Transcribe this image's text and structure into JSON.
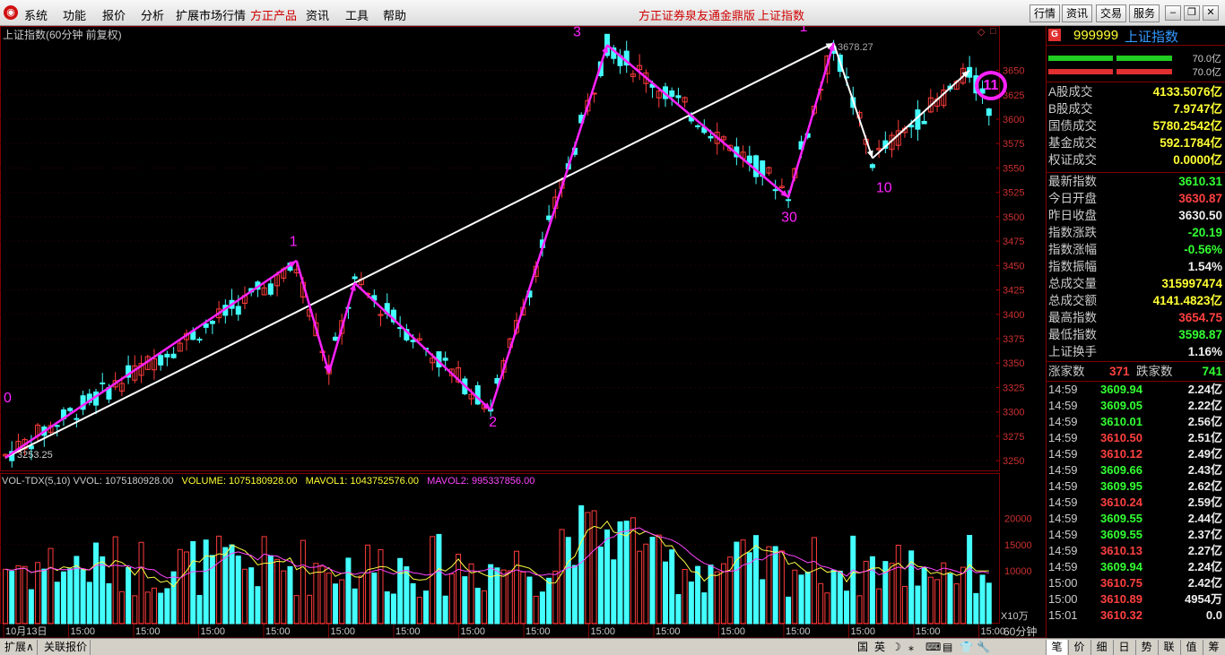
{
  "menu": [
    "系统",
    "功能",
    "报价",
    "分析",
    "扩展市场行情",
    "方正产品",
    "资讯",
    "工具",
    "帮助"
  ],
  "window_title": "方正证券泉友通金鼎版",
  "window_subtitle": "上证指数",
  "nav_buttons": [
    "行情",
    "资讯",
    "交易",
    "服务"
  ],
  "chart": {
    "title": "上证指数(60分钟 前复权)",
    "price_ticks": [
      "3650",
      "3625",
      "3600",
      "3575",
      "3550",
      "3525",
      "3500",
      "3475",
      "3450",
      "3425",
      "3400",
      "3375",
      "3350",
      "3325",
      "3300",
      "3275",
      "3250"
    ],
    "high_label": "3678.27",
    "low_label": "3253.25",
    "wave_labels": [
      "0",
      "1",
      "2",
      "3",
      "1",
      "30",
      "10"
    ],
    "current_badge": "11",
    "vol_header": {
      "name": "VOL-TDX(5,10)",
      "vvol": "VVOL: 1075180928.00",
      "volume": "VOLUME: 1075180928.00",
      "mavol1": "MAVOL1: 1043752576.00",
      "mavol2": "MAVOL2: 995337856.00"
    },
    "vol_ticks": [
      "20000",
      "15000",
      "10000"
    ],
    "vol_unit": "X10万",
    "time_axis": [
      "10月13日",
      "15:00",
      "15:00",
      "15:00",
      "15:00",
      "15:00",
      "15:00",
      "15:00",
      "15:00",
      "15:00",
      "15:00",
      "15:00",
      "15:00",
      "15:00",
      "15:00",
      "15:00"
    ],
    "period_label": "60分钟"
  },
  "side": {
    "code_icon": "G",
    "code": "999999",
    "name": "上证指数",
    "bars": [
      {
        "left": "70.0亿",
        "color": "#22cc22"
      },
      {
        "left": "70.0亿",
        "color": "#e03030"
      }
    ],
    "turnover": [
      {
        "label": "A股成交",
        "value": "4133.5076亿"
      },
      {
        "label": "B股成交",
        "value": "7.9747亿"
      },
      {
        "label": "国债成交",
        "value": "5780.2542亿"
      },
      {
        "label": "基金成交",
        "value": "592.1784亿"
      },
      {
        "label": "权证成交",
        "value": "0.0000亿"
      }
    ],
    "stats": [
      {
        "label": "最新指数",
        "value": "3610.31",
        "color": "#33ff33"
      },
      {
        "label": "今日开盘",
        "value": "3630.87",
        "color": "#ff4040"
      },
      {
        "label": "昨日收盘",
        "value": "3630.50",
        "color": "#eeeeee"
      },
      {
        "label": "指数涨跌",
        "value": "-20.19",
        "color": "#33ff33"
      },
      {
        "label": "指数涨幅",
        "value": "-0.56%",
        "color": "#33ff33"
      },
      {
        "label": "指数振幅",
        "value": "1.54%",
        "color": "#eeeeee"
      },
      {
        "label": "总成交量",
        "value": "315997474",
        "color": "#ffff33"
      },
      {
        "label": "总成交额",
        "value": "4141.4823亿",
        "color": "#ffff33"
      },
      {
        "label": "最高指数",
        "value": "3654.75",
        "color": "#ff4040"
      },
      {
        "label": "最低指数",
        "value": "3598.87",
        "color": "#33ff33"
      },
      {
        "label": "上证换手",
        "value": "1.16%",
        "color": "#eeeeee"
      }
    ],
    "updown": {
      "up_label": "涨家数",
      "up": "371",
      "down_label": "跌家数",
      "down": "741"
    },
    "ticks": [
      {
        "t": "14:59",
        "p": "3609.94",
        "v": "2.24亿"
      },
      {
        "t": "14:59",
        "p": "3609.05",
        "v": "2.22亿"
      },
      {
        "t": "14:59",
        "p": "3610.01",
        "v": "2.56亿"
      },
      {
        "t": "14:59",
        "p": "3610.50",
        "v": "2.51亿"
      },
      {
        "t": "14:59",
        "p": "3610.12",
        "v": "2.49亿"
      },
      {
        "t": "14:59",
        "p": "3609.66",
        "v": "2.43亿"
      },
      {
        "t": "14:59",
        "p": "3609.95",
        "v": "2.62亿"
      },
      {
        "t": "14:59",
        "p": "3610.24",
        "v": "2.59亿"
      },
      {
        "t": "14:59",
        "p": "3609.55",
        "v": "2.44亿"
      },
      {
        "t": "14:59",
        "p": "3609.55",
        "v": "2.37亿"
      },
      {
        "t": "14:59",
        "p": "3610.13",
        "v": "2.27亿"
      },
      {
        "t": "14:59",
        "p": "3609.94",
        "v": "2.24亿"
      },
      {
        "t": "15:00",
        "p": "3610.75",
        "v": "2.42亿"
      },
      {
        "t": "15:00",
        "p": "3610.89",
        "v": "4954万"
      },
      {
        "t": "15:01",
        "p": "3610.32",
        "v": "0.0"
      }
    ]
  },
  "bottom": {
    "tabs": [
      "扩展∧",
      "关联报价"
    ],
    "ime": [
      "国",
      "英",
      "☽",
      "⁎",
      "⌨",
      "▤",
      "👕",
      "🔧"
    ],
    "side_tabs": [
      "笔",
      "价",
      "细",
      "日",
      "势",
      "联",
      "值",
      "筹"
    ]
  }
}
